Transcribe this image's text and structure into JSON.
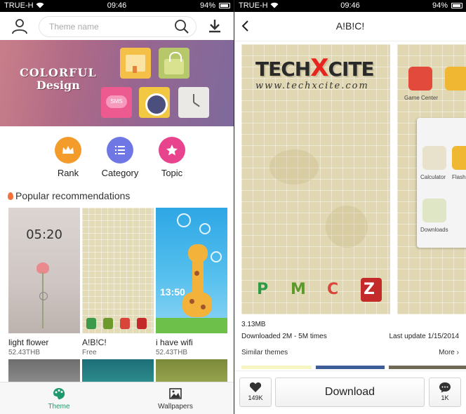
{
  "status_left": {
    "carrier": "TRUE-H",
    "time": "09:46",
    "battery": "94%"
  },
  "status_right": {
    "carrier": "TRUE-H",
    "time": "09:46",
    "battery": "94%"
  },
  "header": {
    "search_placeholder": "Theme name"
  },
  "banner": {
    "line1": "COLORFUL",
    "line2": "Design",
    "sms_label": "SMS"
  },
  "categories": [
    {
      "label": "Rank",
      "icon": "crown-icon",
      "color": "#f39c2c"
    },
    {
      "label": "Category",
      "icon": "list-icon",
      "color": "#6f77e5"
    },
    {
      "label": "Topic",
      "icon": "star-icon",
      "color": "#e8438d"
    }
  ],
  "section_title": "Popular recommendations",
  "themes": [
    {
      "name": "light flower",
      "price": "52.43THB",
      "lock_time": "05:20"
    },
    {
      "name": "A!B!C!",
      "price": "Free"
    },
    {
      "name": "i have wifi",
      "price": "52.43THB",
      "lock_time": "13:50"
    }
  ],
  "bottom_nav": [
    {
      "label": "Theme",
      "active": true,
      "color": "#1e9a6c"
    },
    {
      "label": "Wallpapers",
      "active": false
    }
  ],
  "detail": {
    "title": "A!B!C!",
    "watermark_left": "TECH",
    "watermark_x": "X",
    "watermark_right": "CITE",
    "watermark_url": "www.techxcite.com",
    "preview_labels": [
      "Game Center",
      "Calculator",
      "Flashligh",
      "Downloads"
    ],
    "size": "3.13MB",
    "downloads": "Downloaded 2M - 5M times",
    "last_update": "Last update 1/15/2014",
    "similar_label": "Similar themes",
    "more_label": "More",
    "like_count": "149K",
    "download_label": "Download",
    "comment_count": "1K"
  }
}
